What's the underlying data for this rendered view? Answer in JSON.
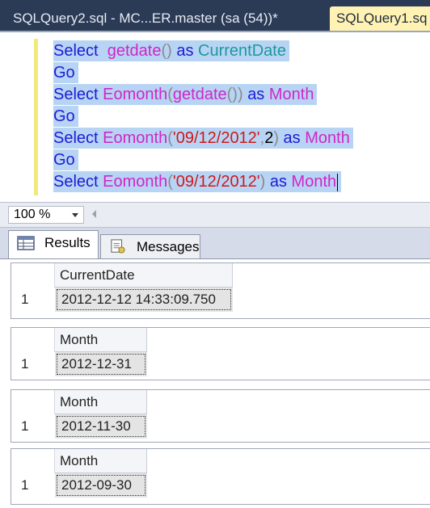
{
  "tabs": {
    "inactive_label": "SQLQuery2.sql - MC...ER.master (sa (54))*",
    "active_label": "SQLQuery1.sq"
  },
  "editor": {
    "line1": {
      "select": "Select",
      "fn": "getdate",
      "open": "(",
      "close": ")",
      "as": "as",
      "alias": "CurrentDate"
    },
    "go1": "Go",
    "line2": {
      "select": "Select",
      "fn": "Eomonth",
      "open": "(",
      "inner_fn": "getdate",
      "inner_parens": "()",
      "close": ")",
      "as": "as",
      "alias": "Month"
    },
    "go2": "Go",
    "line3": {
      "select": "Select",
      "fn": "Eomonth",
      "open": "(",
      "str": "'09/12/2012'",
      "comma": ",",
      "num": "2",
      "close": ")",
      "as": "as",
      "alias": "Month"
    },
    "go3": "Go",
    "line4": {
      "select": "Select",
      "fn": "Eomonth",
      "open": "(",
      "str": "'09/12/2012'",
      "close": ")",
      "as": "as",
      "alias": "Month"
    }
  },
  "zoom": {
    "value": "100 %"
  },
  "results_tabs": {
    "results": "Results",
    "messages": "Messages"
  },
  "grids": [
    {
      "column": "CurrentDate",
      "row": "1",
      "value": "2012-12-12 14:33:09.750"
    },
    {
      "column": "Month",
      "row": "1",
      "value": "2012-12-31"
    },
    {
      "column": "Month",
      "row": "1",
      "value": "2012-11-30"
    },
    {
      "column": "Month",
      "row": "1",
      "value": "2012-09-30"
    }
  ],
  "icons": {
    "results": "grid-icon",
    "messages": "messages-icon",
    "zoom_dropdown": "chevron-down-icon",
    "scroll_left": "arrow-left-icon"
  }
}
